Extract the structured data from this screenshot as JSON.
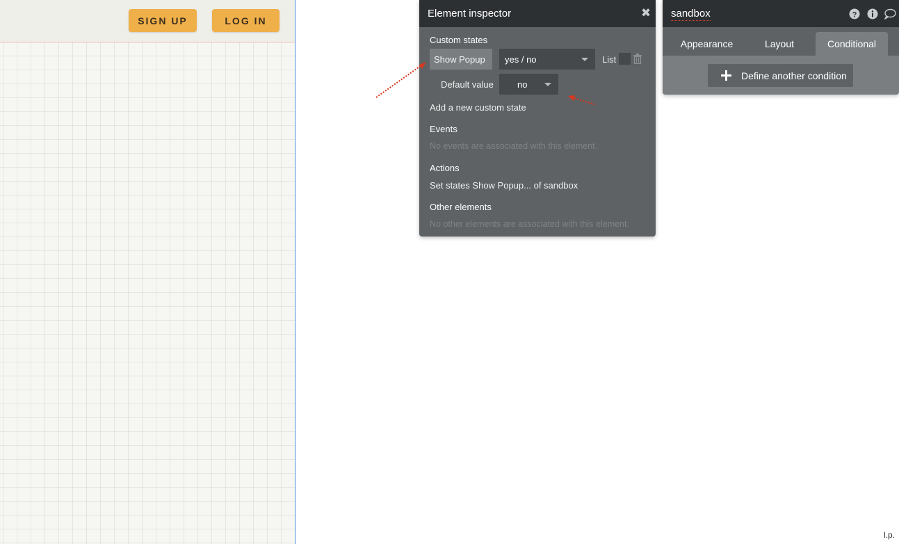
{
  "canvas": {
    "header_buttons": {
      "signup": "SIGN UP",
      "login": "LOG IN"
    }
  },
  "inspector": {
    "title": "Element inspector",
    "close_icon": "close-icon",
    "custom_states_label": "Custom states",
    "state": {
      "name": "Show Popup",
      "type": "yes / no",
      "list_label": "List",
      "default_label": "Default value",
      "default_value": "no"
    },
    "add_state_link": "Add a new custom state",
    "events_label": "Events",
    "events_empty": "No events are associated with this element.",
    "actions_label": "Actions",
    "action_item": "Set states Show Popup... of sandbox",
    "other_label": "Other elements",
    "other_empty": "No other elements are associated with this element."
  },
  "property_editor": {
    "element_name": "sandbox",
    "tabs": [
      {
        "label": "Appearance"
      },
      {
        "label": "Layout"
      },
      {
        "label": "Conditional"
      }
    ],
    "active_tab": "Conditional",
    "define_button": "Define another condition"
  },
  "corner_text": "l.p.",
  "colors": {
    "accent_button": "#efb04a",
    "panel_dark": "#2d3033",
    "panel_body": "#5e6265",
    "annotation_arrow": "#d9381e"
  }
}
